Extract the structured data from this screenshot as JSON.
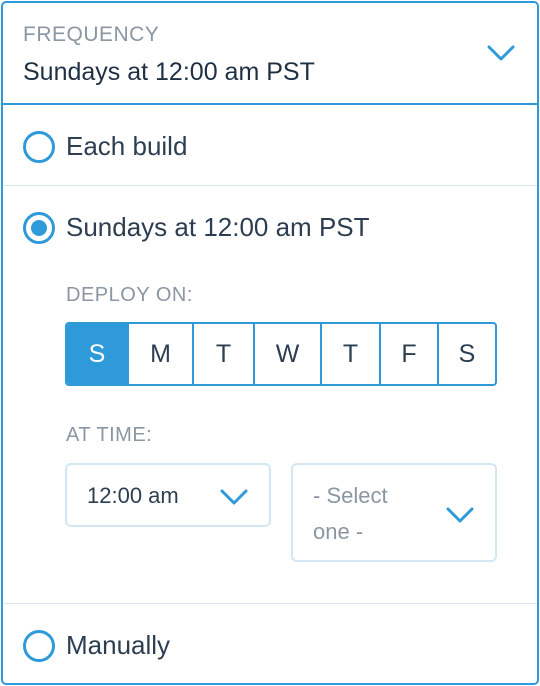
{
  "frequency": {
    "label": "FREQUENCY",
    "value": "Sundays at 12:00 am PST"
  },
  "options": {
    "each_build": "Each build",
    "weekly": "Sundays at 12:00 am PST",
    "manually": "Manually"
  },
  "selected_option": "weekly",
  "deploy_on": {
    "label": "DEPLOY ON:",
    "days": [
      "S",
      "M",
      "T",
      "W",
      "T",
      "F",
      "S"
    ],
    "selected_index": 0
  },
  "at_time": {
    "label": "AT TIME:",
    "time_value": "12:00 am",
    "timezone_line1": "- Select",
    "timezone_line2": "one -"
  },
  "colors": {
    "accent": "#2f9ad9",
    "muted_text": "#8a97a3",
    "text": "#2d3e50",
    "placeholder_text": "#8a97a3"
  }
}
